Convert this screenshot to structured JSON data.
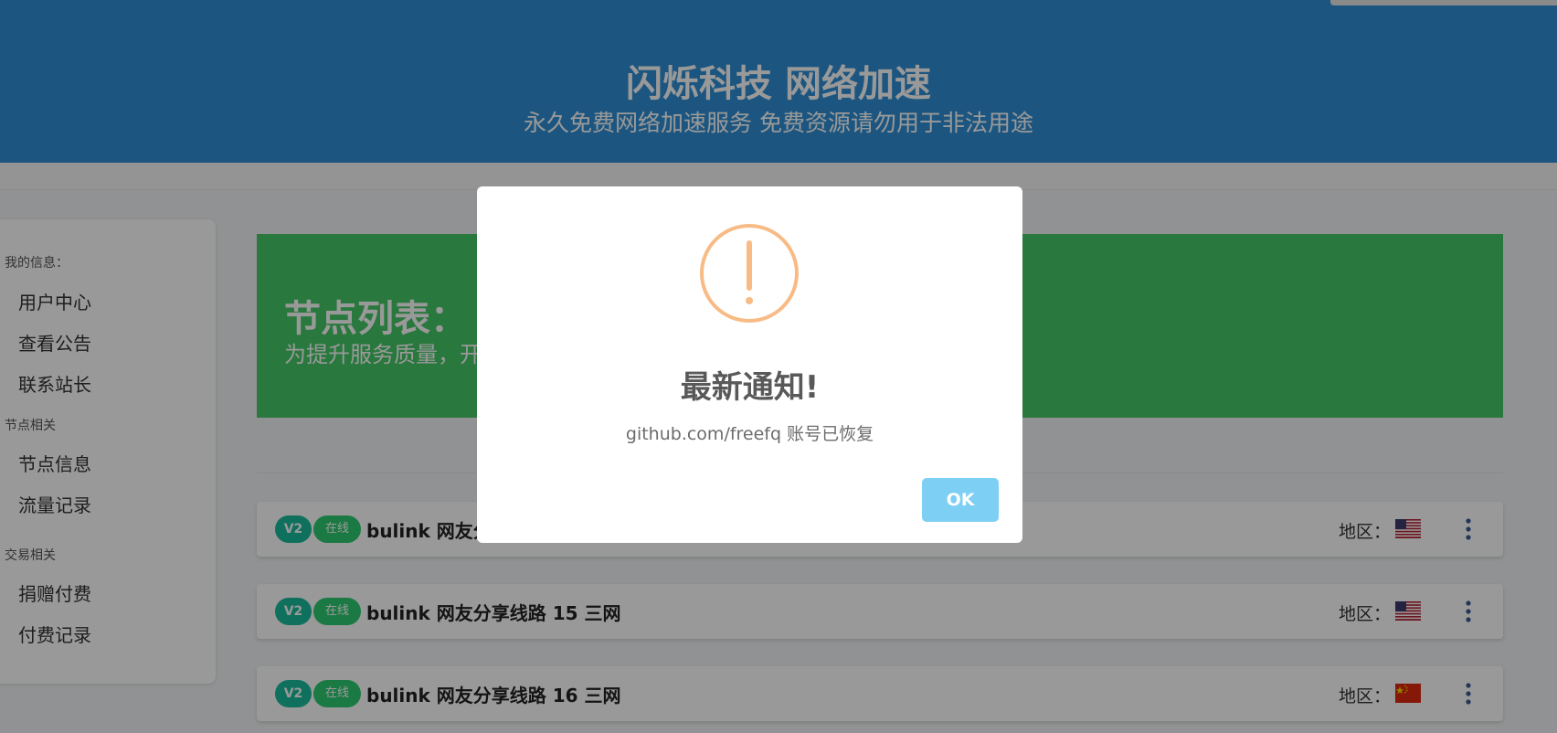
{
  "header": {
    "title": "闪烁科技 网络加速",
    "subtitle": "永久免费网络加速服务 免费资源请勿用于非法用途"
  },
  "sidebar": {
    "sections": [
      {
        "label": "我的信息：",
        "items": [
          "用户中心",
          "查看公告",
          "联系站长"
        ]
      },
      {
        "label": "节点相关",
        "items": [
          "节点信息",
          "流量记录"
        ]
      },
      {
        "label": "交易相关",
        "items": [
          "捐赠付费",
          "付费记录"
        ]
      }
    ]
  },
  "banner": {
    "title": "节点列表：",
    "subtitle": "为提升服务质量，开"
  },
  "nodes": [
    {
      "protocol": "V2",
      "status": "在线",
      "name": "bulink 网友分",
      "region_label": "地区：",
      "flag": "us-flag-icon"
    },
    {
      "protocol": "V2",
      "status": "在线",
      "name": "bulink 网友分享线路 15 三网",
      "region_label": "地区：",
      "flag": "us-flag-icon"
    },
    {
      "protocol": "V2",
      "status": "在线",
      "name": "bulink 网友分享线路 16 三网",
      "region_label": "地区：",
      "flag": "cn-flag-icon"
    }
  ],
  "modal": {
    "title": "最新通知!",
    "message": "github.com/freefq 账号已恢复",
    "ok_label": "OK",
    "icon": "warning-icon"
  },
  "colors": {
    "header": "#2f8fd6",
    "banner": "#45c866",
    "badge_v2": "#1abc9c",
    "badge_online": "#2ecc71",
    "warning": "#f8bb86",
    "ok_button": "#7ecff4",
    "more_icon": "#3b5998"
  }
}
